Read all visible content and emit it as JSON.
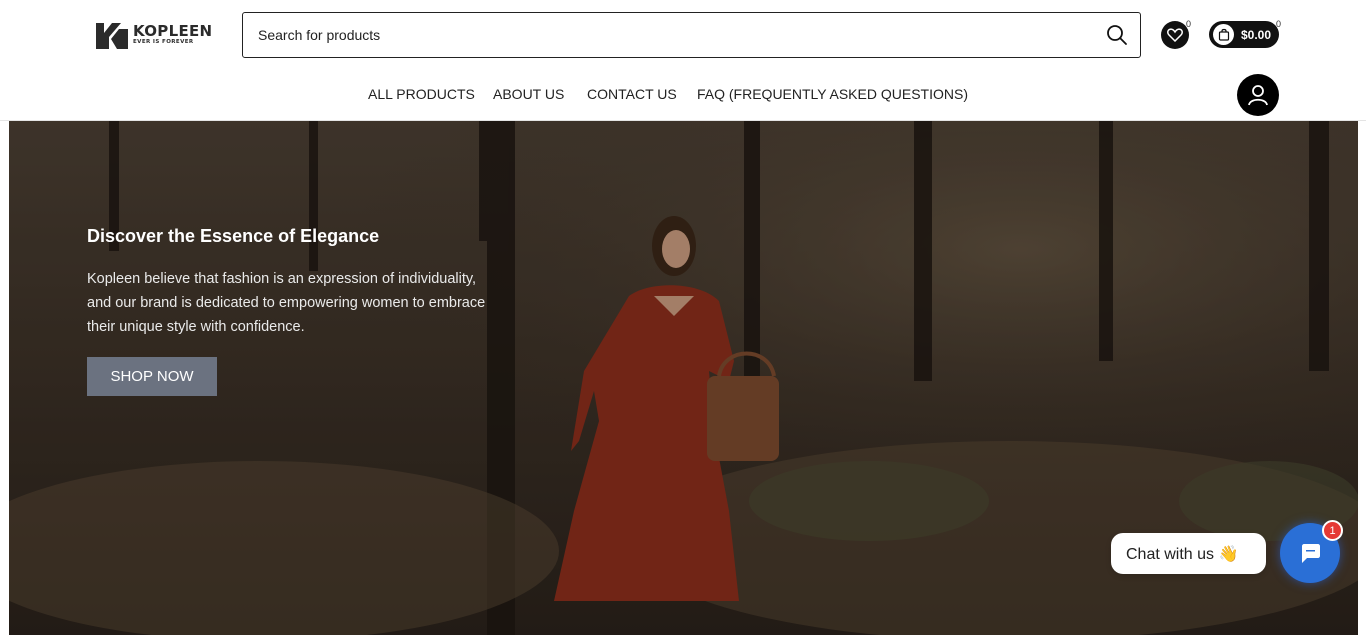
{
  "brand": {
    "name": "KOPLEEN",
    "tagline": "EVER IS FOREVER"
  },
  "search": {
    "placeholder": "Search for products"
  },
  "wishlist": {
    "count": "0"
  },
  "cart": {
    "count": "0",
    "total": "$0.00"
  },
  "nav": {
    "items": [
      "ALL PRODUCTS",
      "ABOUT US",
      "CONTACT US",
      "FAQ (FREQUENTLY ASKED QUESTIONS)"
    ]
  },
  "hero": {
    "title": "Discover the Essence of Elegance",
    "text": "Kopleen believe that fashion is an expression of individuality, and our brand is dedicated to empowering women to embrace their unique style with confidence.",
    "cta": "SHOP NOW"
  },
  "chat": {
    "label": "Chat with us 👋",
    "badge": "1"
  },
  "icons": {
    "search": "search-icon",
    "wishlist": "heart-icon",
    "cart": "shopping-bag-icon",
    "account": "user-icon",
    "chat": "chat-icon"
  },
  "colors": {
    "cta_bg": "#6b7280",
    "chat_accent": "#2a6fd6",
    "badge": "#e53935"
  }
}
